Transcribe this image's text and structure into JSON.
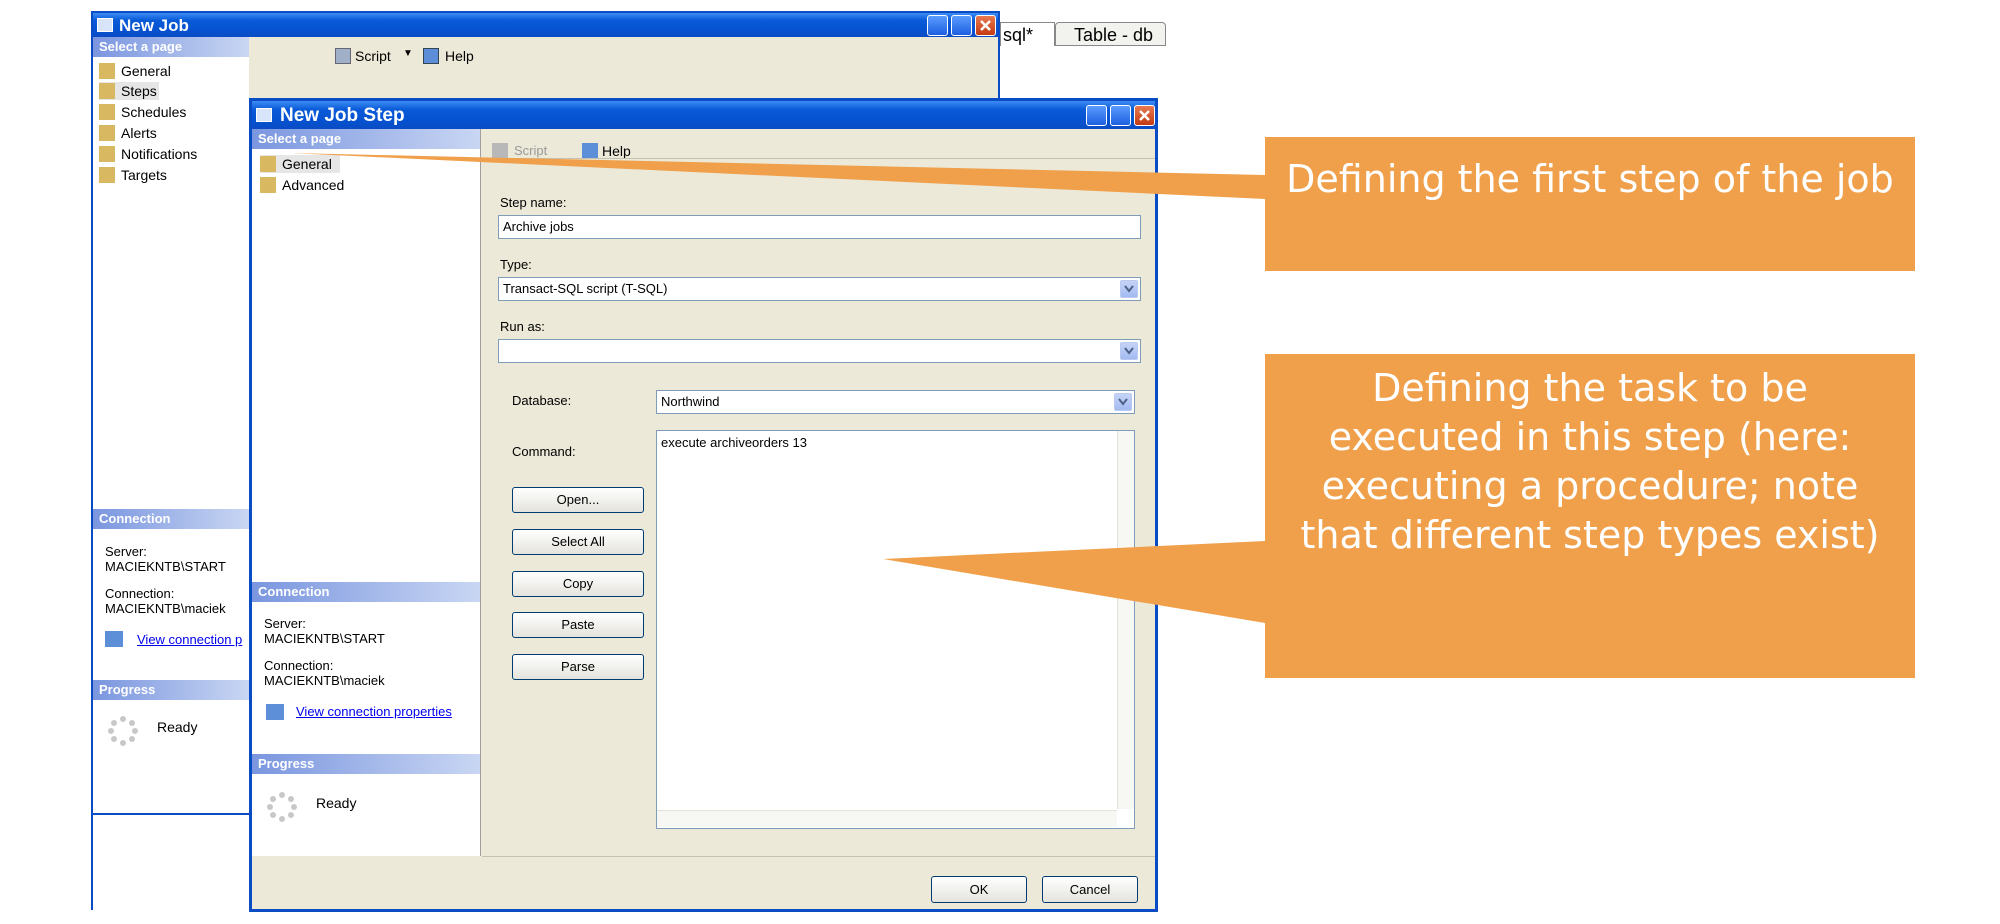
{
  "background_window": {
    "title": "New Job",
    "select_page": "Select a page",
    "pages": [
      "General",
      "Steps",
      "Schedules",
      "Alerts",
      "Notifications",
      "Targets"
    ],
    "toolbar": {
      "script": "Script",
      "help": "Help"
    },
    "tab_fragment": "sql*",
    "tab_table": "Table - db",
    "connection": {
      "header": "Connection",
      "server_label": "Server:",
      "server_value": "MACIEKNTB\\START",
      "connection_label": "Connection:",
      "connection_value": "MACIEKNTB\\maciek",
      "view_link": "View connection p"
    },
    "progress": {
      "header": "Progress",
      "status": "Ready"
    }
  },
  "step_dialog": {
    "title": "New Job Step",
    "select_page": "Select a page",
    "pages": [
      "General",
      "Advanced"
    ],
    "toolbar": {
      "script": "Script",
      "help": "Help"
    },
    "step_name_label": "Step name:",
    "step_name_value": "Archive jobs",
    "type_label": "Type:",
    "type_value": "Transact-SQL script (T-SQL)",
    "run_as_label": "Run as:",
    "run_as_value": "",
    "database_label": "Database:",
    "database_value": "Northwind",
    "command_label": "Command:",
    "command_value": "execute archiveorders 13",
    "buttons": {
      "open": "Open...",
      "select_all": "Select All",
      "copy": "Copy",
      "paste": "Paste",
      "parse": "Parse"
    },
    "connection": {
      "header": "Connection",
      "server_label": "Server:",
      "server_value": "MACIEKNTB\\START",
      "connection_label": "Connection:",
      "connection_value": "MACIEKNTB\\maciek",
      "view_link": "View connection properties"
    },
    "progress": {
      "header": "Progress",
      "status": "Ready"
    },
    "ok": "OK",
    "cancel": "Cancel"
  },
  "callouts": {
    "first": "Defining the first step of the job",
    "second": "Defining the task to be executed in this step (here: executing a procedure; note that different step types exist)"
  },
  "colors": {
    "callout": "#f0a04b",
    "title_bar": "#0a5bd8",
    "page_header": "#7a96df"
  }
}
